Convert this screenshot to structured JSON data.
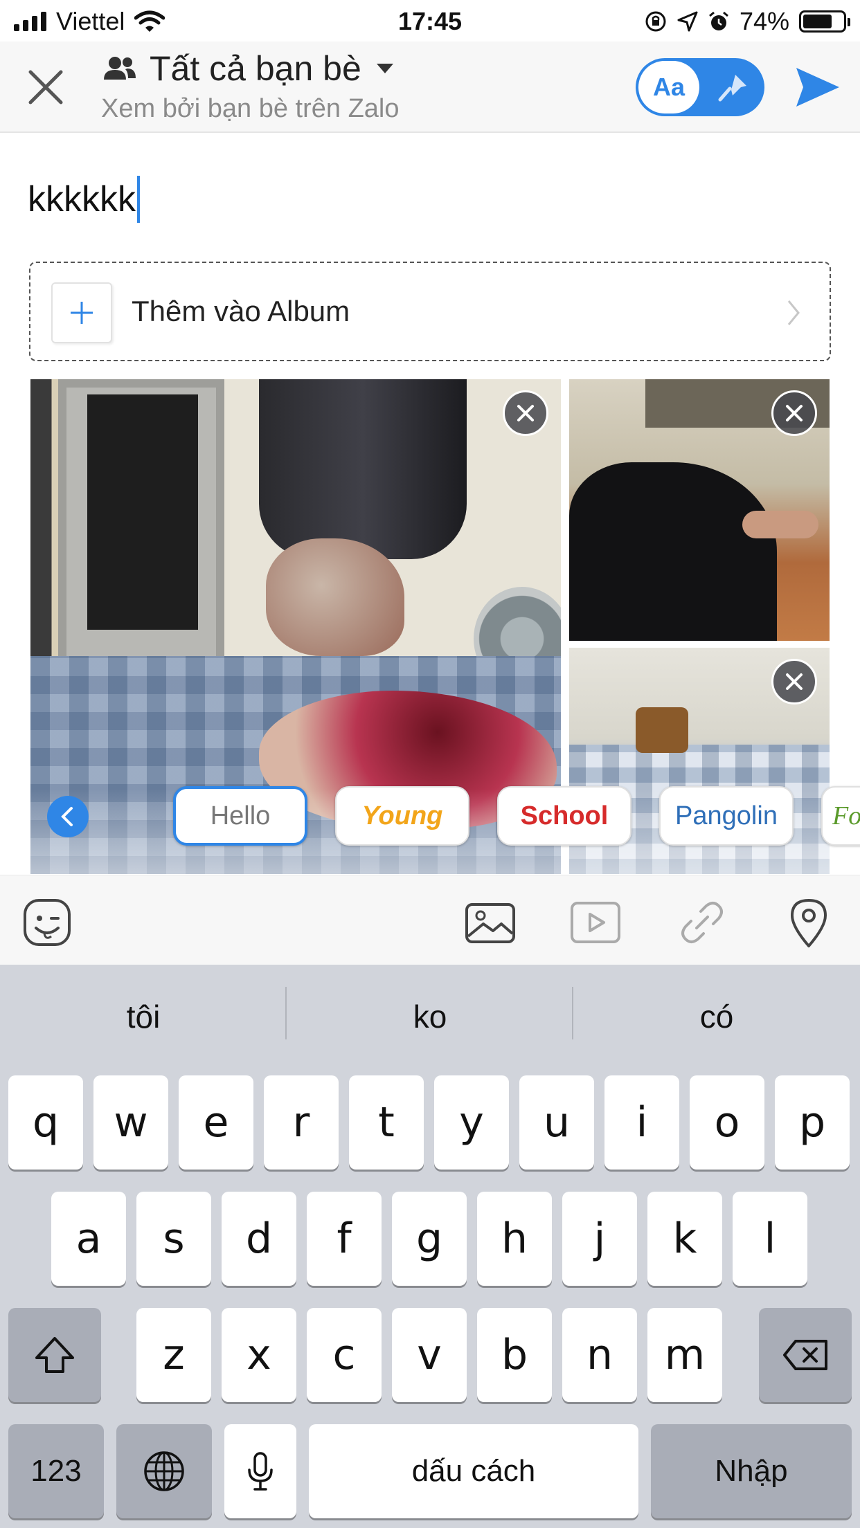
{
  "status_bar": {
    "carrier": "Viettel",
    "time": "17:45",
    "battery": "74%",
    "battery_level": 0.74
  },
  "header": {
    "title": "Tất cả bạn bè",
    "subtitle": "Xem bởi bạn bè trên Zalo",
    "toggle_label": "Aa"
  },
  "post": {
    "text": "kkkkkk"
  },
  "album": {
    "label": "Thêm vào Album"
  },
  "font_chips": [
    {
      "label": "Hello",
      "active": true
    },
    {
      "label": "Young"
    },
    {
      "label": "School"
    },
    {
      "label": "Pangolin"
    },
    {
      "label": "Fo"
    }
  ],
  "toolbar": {
    "icons": [
      "sticker-icon",
      "image-icon",
      "video-icon",
      "link-icon",
      "location-icon"
    ]
  },
  "keyboard": {
    "suggestions": [
      "tôi",
      "ko",
      "có"
    ],
    "row1": [
      "q",
      "w",
      "e",
      "r",
      "t",
      "y",
      "u",
      "i",
      "o",
      "p"
    ],
    "row2": [
      "a",
      "s",
      "d",
      "f",
      "g",
      "h",
      "j",
      "k",
      "l"
    ],
    "row3": [
      "z",
      "x",
      "c",
      "v",
      "b",
      "n",
      "m"
    ],
    "numbers_label": "123",
    "space_label": "dấu cách",
    "return_label": "Nhập"
  },
  "colors": {
    "accent": "#2f86e6",
    "keyboard_bg": "#d1d4db"
  }
}
